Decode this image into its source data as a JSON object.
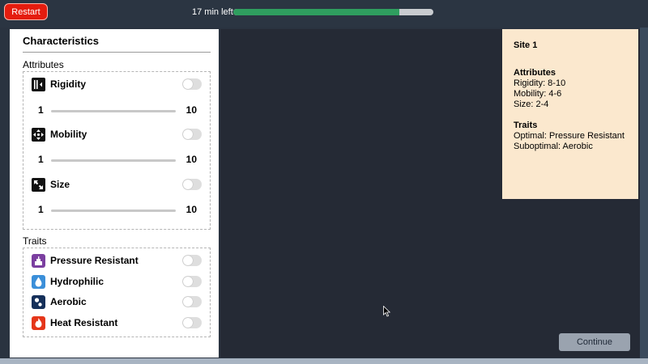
{
  "topbar": {
    "restart_label": "Restart",
    "time_left": "17 min left",
    "progress": 0.83
  },
  "characteristics": {
    "title": "Characteristics",
    "attributes_label": "Attributes",
    "attributes": [
      {
        "name": "Rigidity",
        "icon": "rigidity-icon",
        "min": "1",
        "max": "10"
      },
      {
        "name": "Mobility",
        "icon": "mobility-icon",
        "min": "1",
        "max": "10"
      },
      {
        "name": "Size",
        "icon": "size-icon",
        "min": "1",
        "max": "10"
      }
    ],
    "traits_label": "Traits",
    "traits": [
      {
        "name": "Pressure Resistant",
        "icon": "pressure-icon",
        "color": "#7b3fa0"
      },
      {
        "name": "Hydrophilic",
        "icon": "water-drop-icon",
        "color": "#3b8fd9"
      },
      {
        "name": "Aerobic",
        "icon": "bubbles-icon",
        "color": "#15305a"
      },
      {
        "name": "Heat Resistant",
        "icon": "flame-icon",
        "color": "#e5361a"
      }
    ]
  },
  "site_card": {
    "title": "Site 1",
    "attributes_heading": "Attributes",
    "attributes": [
      "Rigidity: 8-10",
      "Mobility: 4-6",
      "Size: 2-4"
    ],
    "traits_heading": "Traits",
    "traits": [
      "Optimal: Pressure Resistant",
      "Suboptimal: Aerobic"
    ]
  },
  "continue_label": "Continue",
  "colors": {
    "restart": "#e51c0e",
    "progress": "#2f9e5f",
    "canvas": "#252a35",
    "card": "#fbe8ce"
  }
}
